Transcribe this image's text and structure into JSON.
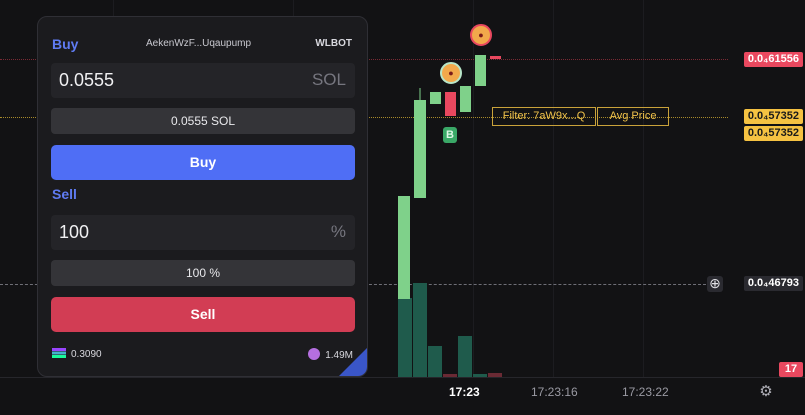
{
  "colors": {
    "background": "#121214",
    "panel_bg": "#1b1b1e",
    "accent_blue": "#5f7bf2",
    "buy_button": "#4f6ef5",
    "sell_button": "#d23d54",
    "candle_up": "#7fd18a",
    "candle_down": "#e9485f",
    "volume_up": "#1f5b4c",
    "price_marker_red": "#e9485f",
    "price_marker_yellow": "#f5c242"
  },
  "panel": {
    "buy_title": "Buy",
    "token_label": "AekenWzF...Uqaupump",
    "bot_label": "WLBOT",
    "buy_amount": "0.0555",
    "buy_unit": "SOL",
    "buy_summary": "0.0555 SOL",
    "buy_button": "Buy",
    "sell_title": "Sell",
    "sell_amount": "100",
    "sell_unit": "%",
    "sell_summary": "100 %",
    "sell_button": "Sell",
    "sol_balance": "0.3090",
    "token_balance": "1.49M"
  },
  "chart": {
    "price_top": "0.0₄61556",
    "price_avg_1": "0.0₄57352",
    "price_avg_2": "0.0₄57352",
    "price_cursor": "0.0₄46793",
    "volume_value": "17",
    "filter_label": "Filter: 7aW9x...Q",
    "avg_price_label": "Avg Price",
    "buy_marker": "B",
    "time_labels": [
      "17:23",
      "17:23:16",
      "17:23:22"
    ]
  }
}
